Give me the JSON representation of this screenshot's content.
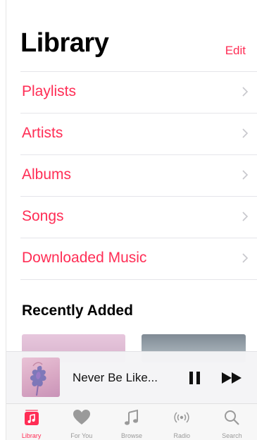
{
  "header": {
    "title": "Library",
    "edit_label": "Edit"
  },
  "library_items": [
    {
      "label": "Playlists"
    },
    {
      "label": "Artists"
    },
    {
      "label": "Albums"
    },
    {
      "label": "Songs"
    },
    {
      "label": "Downloaded Music"
    }
  ],
  "recently_added": {
    "title": "Recently Added"
  },
  "now_playing": {
    "title": "Never Be Like...",
    "pause_icon": "pause-icon",
    "next_icon": "forward-icon"
  },
  "tabs": [
    {
      "label": "Library",
      "icon": "library-icon",
      "active": true
    },
    {
      "label": "For You",
      "icon": "heart-icon",
      "active": false
    },
    {
      "label": "Browse",
      "icon": "music-note-icon",
      "active": false
    },
    {
      "label": "Radio",
      "icon": "radio-icon",
      "active": false
    },
    {
      "label": "Search",
      "icon": "search-icon",
      "active": false
    }
  ],
  "colors": {
    "accent": "#ff2d55",
    "inactive": "#9a9a9a"
  }
}
